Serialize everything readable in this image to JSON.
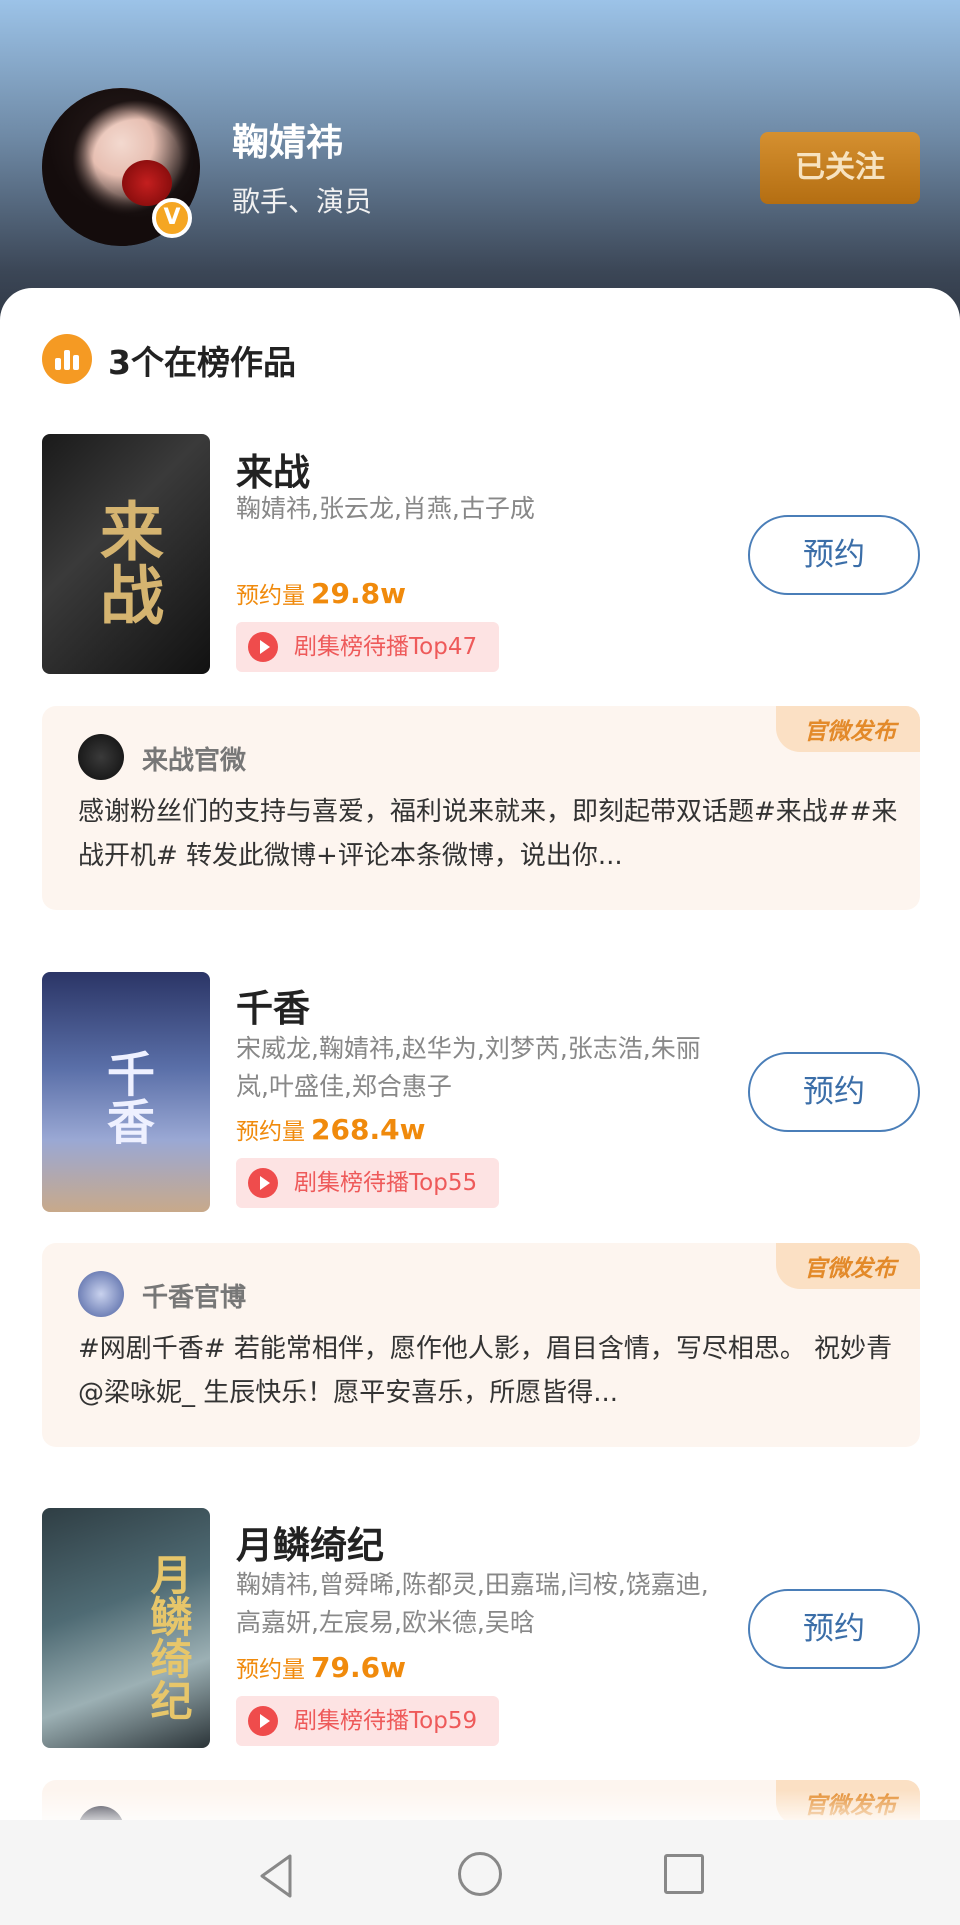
{
  "profile": {
    "name": "鞠婧祎",
    "role": "歌手、演员",
    "verified_label": "V",
    "follow_label": "已关注"
  },
  "section": {
    "title": "3个在榜作品"
  },
  "works": [
    {
      "title": "来战",
      "cast": "鞠婧祎,张云龙,肖燕,古子成",
      "reserve_label": "预约量",
      "reserve_count": "29.8w",
      "rank": "剧集榜待播Top47",
      "reserve_button": "预约",
      "poster_text": "来战",
      "post": {
        "badge": "官微发布",
        "account": "来战官微",
        "text": "感谢粉丝们的支持与喜爱，福利说来就来，即刻起带双话题#来战##来战开机# 转发此微博+评论本条微博，说出你..."
      }
    },
    {
      "title": "千香",
      "cast": "宋威龙,鞠婧祎,赵华为,刘梦芮,张志浩,朱丽岚,叶盛佳,郑合惠子",
      "reserve_label": "预约量",
      "reserve_count": "268.4w",
      "rank": "剧集榜待播Top55",
      "reserve_button": "预约",
      "poster_text": "千香",
      "post": {
        "badge": "官微发布",
        "account": "千香官博",
        "text": "#网剧千香# 若能常相伴，愿作他人影，眉目含情，写尽相思。 祝妙青@梁咏妮_ 生辰快乐！愿平安喜乐，所愿皆得..."
      }
    },
    {
      "title": "月鳞绮纪",
      "cast": "鞠婧祎,曾舜晞,陈都灵,田嘉瑞,闫桉,饶嘉迪,高嘉妍,左宸易,欧米德,吴晗",
      "reserve_label": "预约量",
      "reserve_count": "79.6w",
      "rank": "剧集榜待播Top59",
      "reserve_button": "预约",
      "poster_text": "月鳞绮纪",
      "post": {
        "badge": "官微发布"
      }
    }
  ]
}
